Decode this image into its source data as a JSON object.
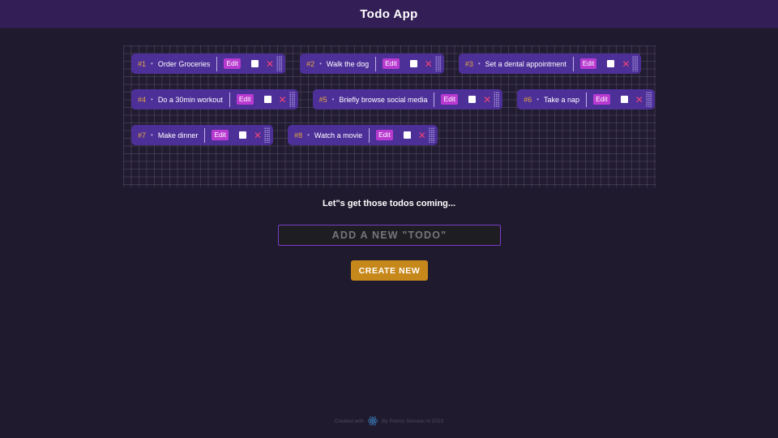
{
  "header": {
    "title": "Todo App"
  },
  "todos": [
    {
      "num": "#1",
      "title": "Order Groceries",
      "edit": "Edit",
      "delete": "✕"
    },
    {
      "num": "#2",
      "title": "Walk the dog",
      "edit": "Edit",
      "delete": "✕"
    },
    {
      "num": "#3",
      "title": "Set a dental appointment",
      "edit": "Edit",
      "delete": "✕"
    },
    {
      "num": "#4",
      "title": "Do a 30min workout",
      "edit": "Edit",
      "delete": "✕"
    },
    {
      "num": "#5",
      "title": "Briefly browse social media",
      "edit": "Edit",
      "delete": "✕"
    },
    {
      "num": "#6",
      "title": "Take a nap",
      "edit": "Edit",
      "delete": "✕"
    },
    {
      "num": "#7",
      "title": "Make dinner",
      "edit": "Edit",
      "delete": "✕"
    },
    {
      "num": "#8",
      "title": "Watch a movie",
      "edit": "Edit",
      "delete": "✕"
    }
  ],
  "main": {
    "tagline": "Let\"s get those todos coming...",
    "input_placeholder": "ADD A NEW \"TODO\"",
    "create_label": "CREATE NEW"
  },
  "footer": {
    "prefix": "Created with",
    "suffix": "By Petros Skoulas in 2023",
    "logo_icon": "react-logo-icon"
  },
  "colors": {
    "background": "#1f1a2d",
    "header": "#331f55",
    "todo_card": "#4d2f98",
    "edit_button": "#b83ad0",
    "delete_icon": "#ee4474",
    "number": "#e2a83b",
    "create_button": "#c7881b",
    "input_border": "#7a3dc8"
  }
}
